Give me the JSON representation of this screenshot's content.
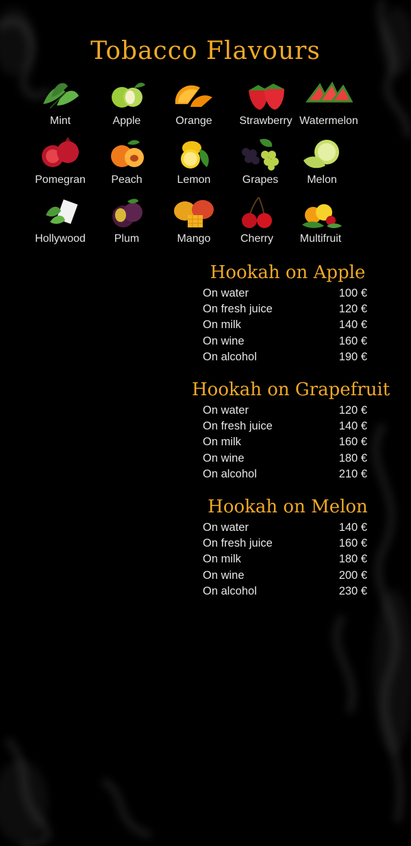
{
  "title": "Tobacco Flavours",
  "flavors": [
    {
      "name": "Mint",
      "icon": "mint-icon"
    },
    {
      "name": "Apple",
      "icon": "apple-icon"
    },
    {
      "name": "Orange",
      "icon": "orange-icon"
    },
    {
      "name": "Strawberry",
      "icon": "strawberry-icon"
    },
    {
      "name": "Watermelon",
      "icon": "watermelon-icon"
    },
    {
      "name": "Pomegran",
      "icon": "pomegranate-icon"
    },
    {
      "name": "Peach",
      "icon": "peach-icon"
    },
    {
      "name": "Lemon",
      "icon": "lemon-icon"
    },
    {
      "name": "Grapes",
      "icon": "grapes-icon"
    },
    {
      "name": "Melon",
      "icon": "melon-icon"
    },
    {
      "name": "Hollywood",
      "icon": "hollywood-gum-icon"
    },
    {
      "name": "Plum",
      "icon": "plum-icon"
    },
    {
      "name": "Mango",
      "icon": "mango-icon"
    },
    {
      "name": "Cherry",
      "icon": "cherry-icon"
    },
    {
      "name": "Multifruit",
      "icon": "multifruit-icon"
    }
  ],
  "sections": [
    {
      "title": "Hookah on Apple",
      "items": [
        {
          "name": "On water",
          "price": "100 €"
        },
        {
          "name": "On fresh juice",
          "price": "120 €"
        },
        {
          "name": "On milk",
          "price": "140 €"
        },
        {
          "name": "On wine",
          "price": "160 €"
        },
        {
          "name": "On alcohol",
          "price": "190 €"
        }
      ]
    },
    {
      "title": "Hookah on Grapefruit",
      "items": [
        {
          "name": "On water",
          "price": "120 €"
        },
        {
          "name": "On fresh juice",
          "price": "140 €"
        },
        {
          "name": "On milk",
          "price": "160 €"
        },
        {
          "name": "On wine",
          "price": "180 €"
        },
        {
          "name": "On alcohol",
          "price": "210 €"
        }
      ]
    },
    {
      "title": "Hookah on Melon",
      "items": [
        {
          "name": "On water",
          "price": "140 €"
        },
        {
          "name": "On fresh juice",
          "price": "160 €"
        },
        {
          "name": "On milk",
          "price": "180 €"
        },
        {
          "name": "On wine",
          "price": "200 €"
        },
        {
          "name": "On alcohol",
          "price": "230 €"
        }
      ]
    }
  ],
  "colors": {
    "background": "#000000",
    "accent": "#f0a928",
    "text": "#e6e6e6"
  }
}
